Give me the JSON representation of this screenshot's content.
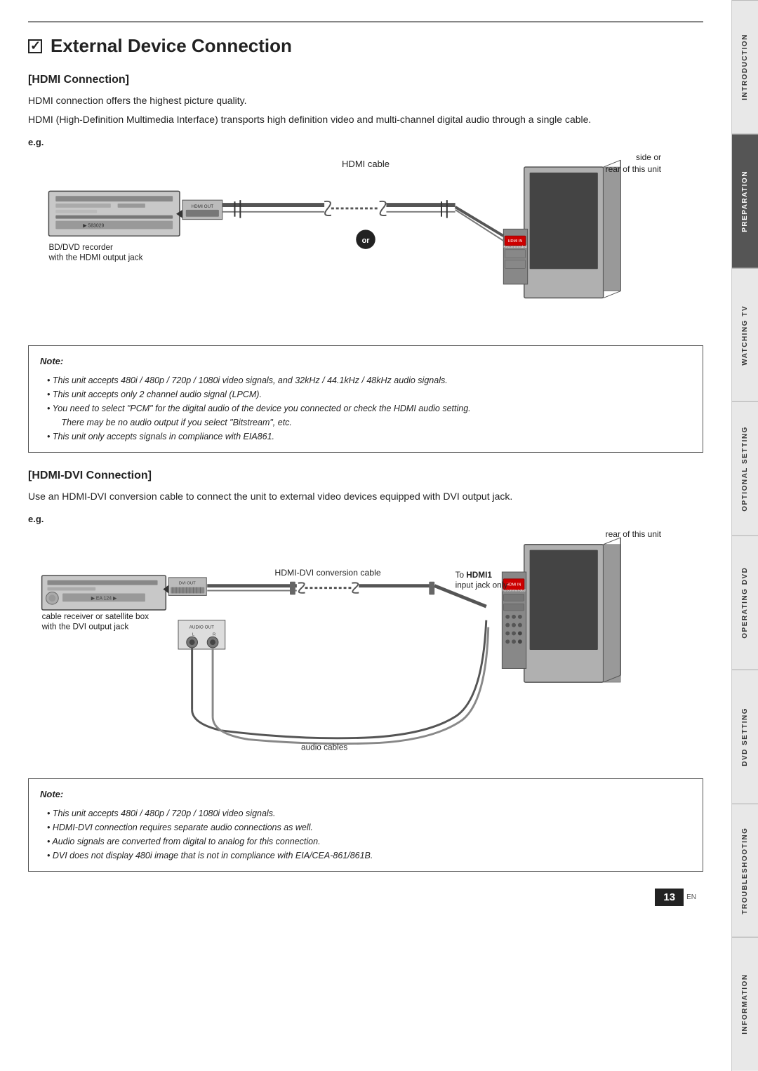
{
  "page": {
    "title": "External Device Connection",
    "number": "13",
    "number_suffix": "EN"
  },
  "sidebar": {
    "tabs": [
      {
        "label": "INTRODUCTION",
        "active": false
      },
      {
        "label": "PREPARATION",
        "active": true
      },
      {
        "label": "WATCHING TV",
        "active": false
      },
      {
        "label": "OPTIONAL SETTING",
        "active": false
      },
      {
        "label": "OPERATING DVD",
        "active": false
      },
      {
        "label": "DVD SETTING",
        "active": false
      },
      {
        "label": "TROUBLESHOOTING",
        "active": false
      },
      {
        "label": "INFORMATION",
        "active": false
      }
    ]
  },
  "hdmi_section": {
    "header": "[HDMI Connection]",
    "para1": "HDMI connection offers the highest picture quality.",
    "para2": "HDMI (High-Definition Multimedia Interface) transports high definition video and multi-channel digital audio through a single cable.",
    "eg_label": "e.g.",
    "side_rear": "side or\nrear of this unit",
    "hdmi_cable_label": "HDMI cable",
    "device_label": "BD/DVD recorder\nwith the HDMI output jack",
    "hdmi_out_text": "HDMI OUT",
    "or_text": "or",
    "note": {
      "title": "Note:",
      "items": [
        "This unit accepts 480i / 480p / 720p / 1080i video signals, and 32kHz / 44.1kHz / 48kHz audio signals.",
        "This unit accepts only 2 channel audio signal (LPCM).",
        "You need to select \"PCM\" for the digital audio of the device you connected or check the HDMI audio setting. There may be no audio output if you select \"Bitstream\", etc.",
        "This unit only accepts signals in compliance with EIA861."
      ]
    }
  },
  "hdmi_dvi_section": {
    "header": "[HDMI-DVI Connection]",
    "para1": "Use an HDMI-DVI conversion cable to connect the unit to external video devices equipped with DVI output jack.",
    "eg_label": "e.g.",
    "rear_label": "rear of this unit",
    "cable_label": "HDMI-DVI conversion cable",
    "hdmi1_label": "To HDMI1\ninput jack only",
    "dvi_out_text": "DVI OUT",
    "audio_out_text": "AUDIO OUT\nL       R",
    "device_label": "cable receiver or satellite box\nwith the DVI output jack",
    "audio_cables_label": "audio cables",
    "note": {
      "title": "Note:",
      "items": [
        "This unit accepts 480i / 480p / 720p / 1080i video signals.",
        "HDMI-DVI connection requires separate audio connections as well.",
        "Audio signals are converted from digital to analog for this connection.",
        "DVI does not display 480i image that is not in compliance with EIA/CEA-861/861B."
      ]
    }
  }
}
